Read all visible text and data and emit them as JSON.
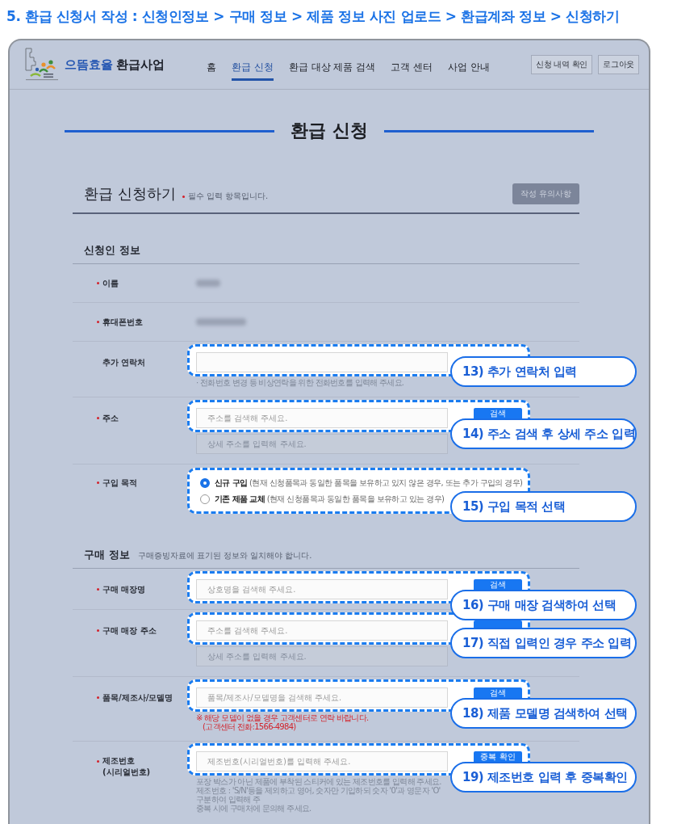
{
  "page_heading": "5. 환급 신청서 작성 : 신청인정보 > 구매 정보 > 제품 정보 사진 업로드 > 환급계좌 정보 > 신청하기",
  "site_header": {
    "brand": {
      "highlight": "으뜸효율",
      "name": "환급사업"
    },
    "nav": [
      {
        "label": "홈",
        "selected": false
      },
      {
        "label": "환급 신청",
        "selected": true
      },
      {
        "label": "환급 대상 제품 검색",
        "selected": false
      },
      {
        "label": "고객 센터",
        "selected": false
      },
      {
        "label": "사업 안내",
        "selected": false
      }
    ],
    "buttons": [
      "신청 내역 확인",
      "로그아웃"
    ]
  },
  "page_title": "환급 신청",
  "form": {
    "title": "환급 신청하기",
    "required_note": "필수 입력 항목입니다.",
    "guide_button": "작성 유의사항",
    "sections": [
      {
        "title": "신청인 정보",
        "rows": [
          {
            "kind": "blurred",
            "label": "이름",
            "required": true
          },
          {
            "kind": "blurred",
            "label": "휴대폰번호",
            "required": true
          },
          {
            "kind": "input",
            "label": "추가 연락처",
            "required": false,
            "fields": [
              {
                "disabled": false
              }
            ],
            "notes": [
              {
                "kind": "muted",
                "text": "· 전화번호 변경 등 비상연락을 위한 전화번호를 입력해 주세요."
              }
            ],
            "callout": "13) 추가 연락처 입력"
          },
          {
            "kind": "input",
            "label": "주소",
            "required": true,
            "fields": [
              {
                "placeholder": "주소를 검색해 주세요.",
                "disabled": false,
                "button": true,
                "button_label": "검색"
              },
              {
                "placeholder": "상세 주소를 입력해 주세요.",
                "disabled": true
              }
            ],
            "callout": "14) 주소 검색 후 상세 주소 입력"
          },
          {
            "kind": "radio",
            "label": "구입 목적",
            "required": true,
            "options": [
              {
                "text": "**신규 구입** (현재 신청품목과 동일한 품목을 보유하고 있지 않은 경우, 또는 추가 구입의 경우)",
                "selected": true
              },
              {
                "text": "**기존 제품 교체** (현재 신청품목과 동일한 품목을 보유하고 있는 경우)",
                "selected": false
              }
            ],
            "callout": "15) 구입 목적 선택"
          }
        ]
      },
      {
        "title": "구매 정보",
        "note": "구매증빙자료에 표기된 정보와 일치해야 합니다.",
        "rows": [
          {
            "kind": "input",
            "label": "구매 매장명",
            "required": true,
            "fields": [
              {
                "placeholder": "상호명을 검색해 주세요.",
                "disabled": false,
                "button": true,
                "button_label": "검색"
              }
            ],
            "callout": "16) 구매 매장 검색하여 선택"
          },
          {
            "kind": "input",
            "label": "구매 매장 주소",
            "required": true,
            "fields": [
              {
                "placeholder": "주소를 검색해 주세요.",
                "disabled": false,
                "button": true
              },
              {
                "placeholder": "상세 주소를 입력해 주세요.",
                "disabled": true
              }
            ],
            "callout": "17) 직접 입력인 경우 주소 입력"
          },
          {
            "kind": "input",
            "label": "품목/제조사/모델명",
            "required": true,
            "fields": [
              {
                "placeholder": "품목/제조사/모델명을 검색해 주세요.",
                "disabled": false,
                "button": true,
                "button_label": "검색"
              }
            ],
            "notes": [
              {
                "kind": "alert",
                "text": "※ 해당 모델이 없을 경우 고객센터로 연락 바랍니다.",
                "continuation": "(고객센터 전화:1566-4984)"
              }
            ],
            "callout": "18) 제품 모델명 검색하여 선택"
          },
          {
            "kind": "input",
            "label": "제조번호",
            "label_note": "(시리얼번호)",
            "required": true,
            "fields": [
              {
                "placeholder": "제조번호(시리얼번호)를 입력해 주세요.",
                "disabled": false,
                "button": true,
                "button_label": "중복 확인"
              }
            ],
            "notes": [
              {
                "kind": "muted",
                "text": "포장 박스가 아닌 제품에 부착된 스티커에 있는 제조번호를 입력해 주세요."
              },
              {
                "kind": "muted",
                "text": "제조번호 : 'S/N'등을 제외하고 영어, 숫자만 기입하되 숫자 '0'과 영문자 'O' 구분하여 입력해 주"
              },
              {
                "kind": "muted",
                "text": "중복 시에 구매처에 문의해 주세요."
              }
            ],
            "callout": "19) 제조번호 입력 후 중복확인"
          }
        ]
      }
    ]
  }
}
